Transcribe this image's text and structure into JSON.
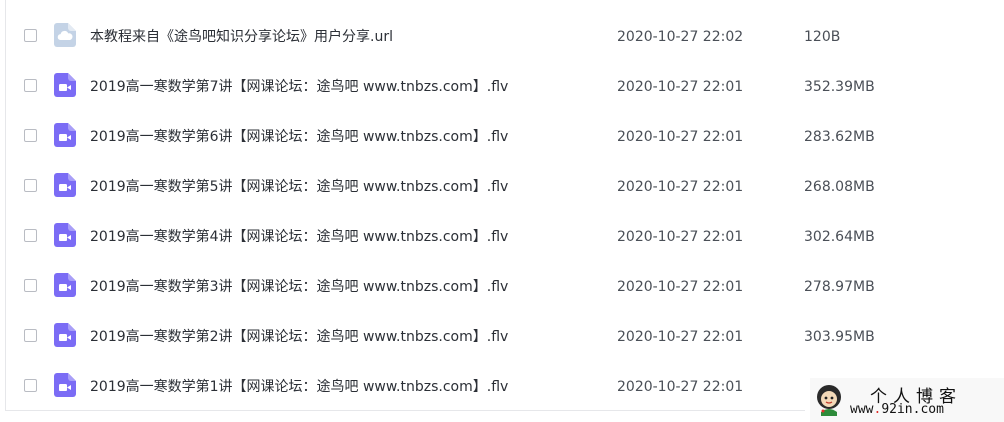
{
  "colors": {
    "video_icon": "#7b6cf5",
    "link_icon": "#c4d3e6",
    "text_primary": "#2b2f36",
    "text_secondary": "#4a4f57",
    "checkbox_border": "#b9bcc3"
  },
  "files": [
    {
      "icon": "link-file-icon",
      "name": "本教程来自《途鸟吧知识分享论坛》用户分享.url",
      "date": "2020-10-27 22:02",
      "size": "120B"
    },
    {
      "icon": "video-file-icon",
      "name": "2019高一寒数学第7讲【网课论坛：途鸟吧 www.tnbzs.com】.flv",
      "date": "2020-10-27 22:01",
      "size": "352.39MB"
    },
    {
      "icon": "video-file-icon",
      "name": "2019高一寒数学第6讲【网课论坛：途鸟吧 www.tnbzs.com】.flv",
      "date": "2020-10-27 22:01",
      "size": "283.62MB"
    },
    {
      "icon": "video-file-icon",
      "name": "2019高一寒数学第5讲【网课论坛：途鸟吧 www.tnbzs.com】.flv",
      "date": "2020-10-27 22:01",
      "size": "268.08MB"
    },
    {
      "icon": "video-file-icon",
      "name": "2019高一寒数学第4讲【网课论坛：途鸟吧 www.tnbzs.com】.flv",
      "date": "2020-10-27 22:01",
      "size": "302.64MB"
    },
    {
      "icon": "video-file-icon",
      "name": "2019高一寒数学第3讲【网课论坛：途鸟吧 www.tnbzs.com】.flv",
      "date": "2020-10-27 22:01",
      "size": "278.97MB"
    },
    {
      "icon": "video-file-icon",
      "name": "2019高一寒数学第2讲【网课论坛：途鸟吧 www.tnbzs.com】.flv",
      "date": "2020-10-27 22:01",
      "size": "303.95MB"
    },
    {
      "icon": "video-file-icon",
      "name": "2019高一寒数学第1讲【网课论坛：途鸟吧 www.tnbzs.com】.flv",
      "date": "2020-10-27 22:01",
      "size": ""
    }
  ],
  "watermark": {
    "title": "个人博客",
    "url_prefix": "www",
    "url_dot": ".",
    "url_rest": "92in.com"
  }
}
